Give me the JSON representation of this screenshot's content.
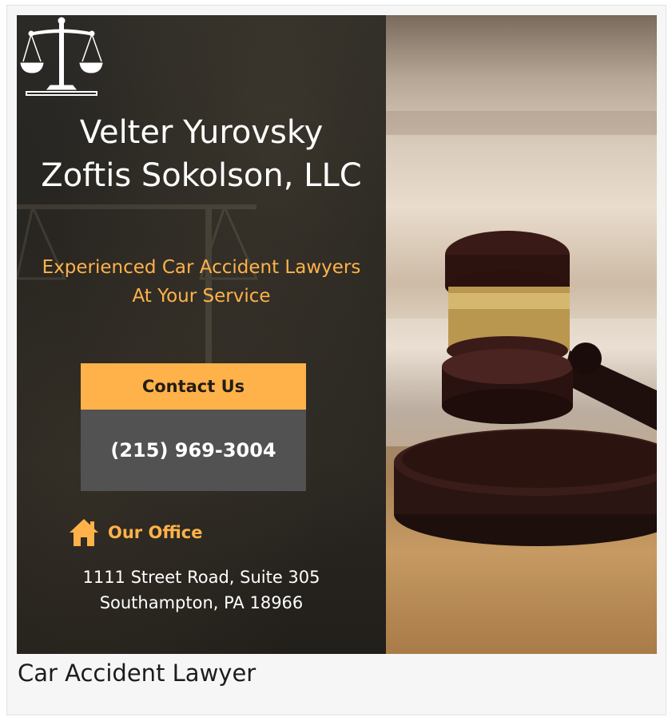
{
  "banner": {
    "logo_icon": "scales-of-justice-icon",
    "firm_name_line1": "Velter Yurovsky",
    "firm_name_line2": "Zoftis Sokolson, LLC",
    "tagline_line1": "Experienced Car Accident Lawyers",
    "tagline_line2": "At Your Service",
    "contact_button": "Contact Us",
    "phone": "(215) 969-3004",
    "office_icon": "home-icon",
    "office_title": "Our Office",
    "address_line1": "1111 Street Road, Suite 305",
    "address_line2": "Southampton, PA 18966",
    "image_subject": "gavel-on-sound-block"
  },
  "caption": "Car Accident Lawyer",
  "colors": {
    "accent": "#ffb24a",
    "dark_panel": "#252320",
    "phone_box": "#525252",
    "text_light": "#ffffff"
  }
}
